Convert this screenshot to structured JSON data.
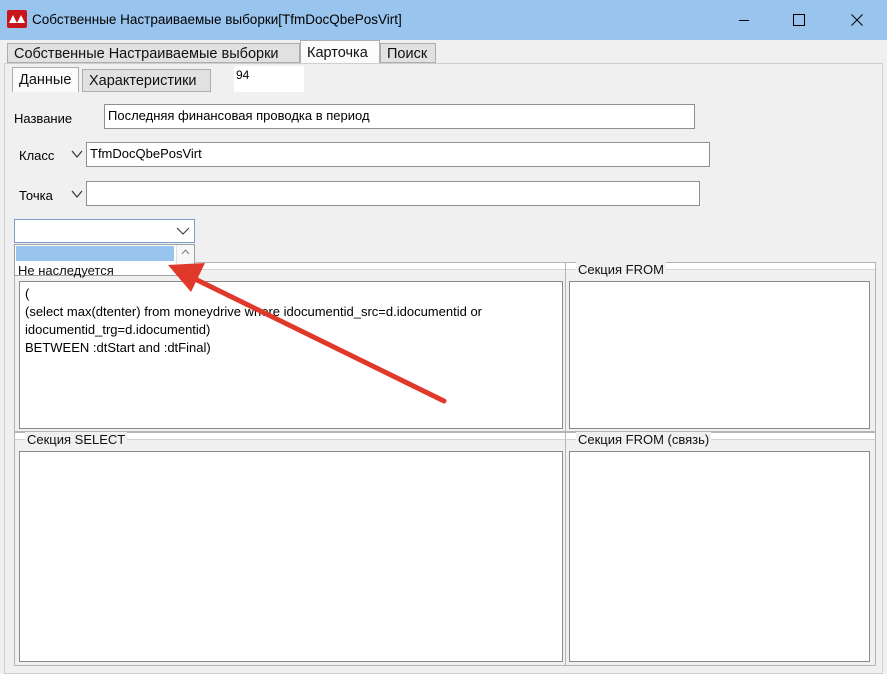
{
  "window": {
    "title": "Собственные Настраиваемые выборки[TfmDocQbePosVirt]",
    "icons": {
      "app": "app-logo-icon",
      "minimize": "minimize-icon",
      "maximize": "maximize-icon",
      "close": "close-icon"
    }
  },
  "main_tabs": [
    {
      "label": "Собственные Настраиваемые выборки"
    },
    {
      "label": "Карточка"
    },
    {
      "label": "Поиск"
    }
  ],
  "sub_tabs": [
    {
      "label": "Данные"
    },
    {
      "label": "Характеристики"
    }
  ],
  "record_id": "94",
  "form": {
    "name_label": "Название",
    "name_value": "Последняя финансовая проводка в период",
    "class_label": "Класс",
    "class_value": "TfmDocQbePosVirt",
    "point_label": "Точка",
    "point_value": ""
  },
  "combo": {
    "value": "",
    "dropdown_selected_item": "",
    "dropdown_item": "Не наследуется"
  },
  "sections": {
    "where_title": "Не наследуется",
    "where_lines": [
      "(",
      "(select max(dtenter) from moneydrive where idocumentid_src=d.idocumentid or",
      "idocumentid_trg=d.idocumentid)",
      "BETWEEN :dtStart and :dtFinal)"
    ],
    "from_title": "Секция FROM",
    "select_title": "Секция SELECT",
    "from_link_title": "Секция FROM (связь)"
  },
  "colors": {
    "titlebar": "#99c4ee",
    "annotation_arrow": "#e0392b",
    "selection": "#99c4ee"
  }
}
